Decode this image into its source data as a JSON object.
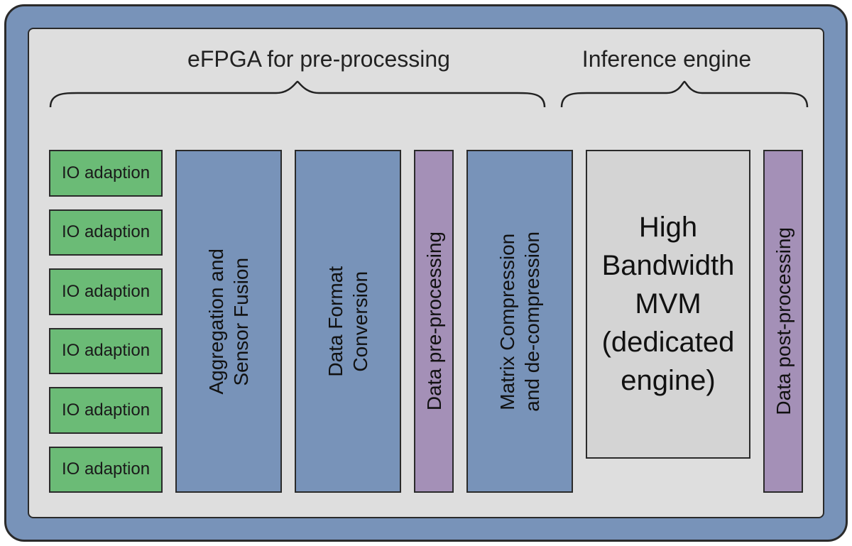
{
  "headers": {
    "left": "eFPGA for pre-processing",
    "right": "Inference engine"
  },
  "io_label": "IO adaption",
  "io_count": 6,
  "blocks": {
    "aggregation": "Aggregation and\nSensor Fusion",
    "format": "Data Format\nConversion",
    "preproc": "Data pre-processing",
    "matrix": "Matrix Compression\nand de-compression",
    "mvm": "High Bandwidth MVM (dedicated engine)",
    "postproc": "Data post-processing"
  },
  "colors": {
    "frame": "#7893b9",
    "panel": "#dedede",
    "green": "#6bbb76",
    "blue": "#7893b9",
    "purple": "#a490b7",
    "grey": "#d4d4d4",
    "stroke": "#2a2a2a"
  }
}
